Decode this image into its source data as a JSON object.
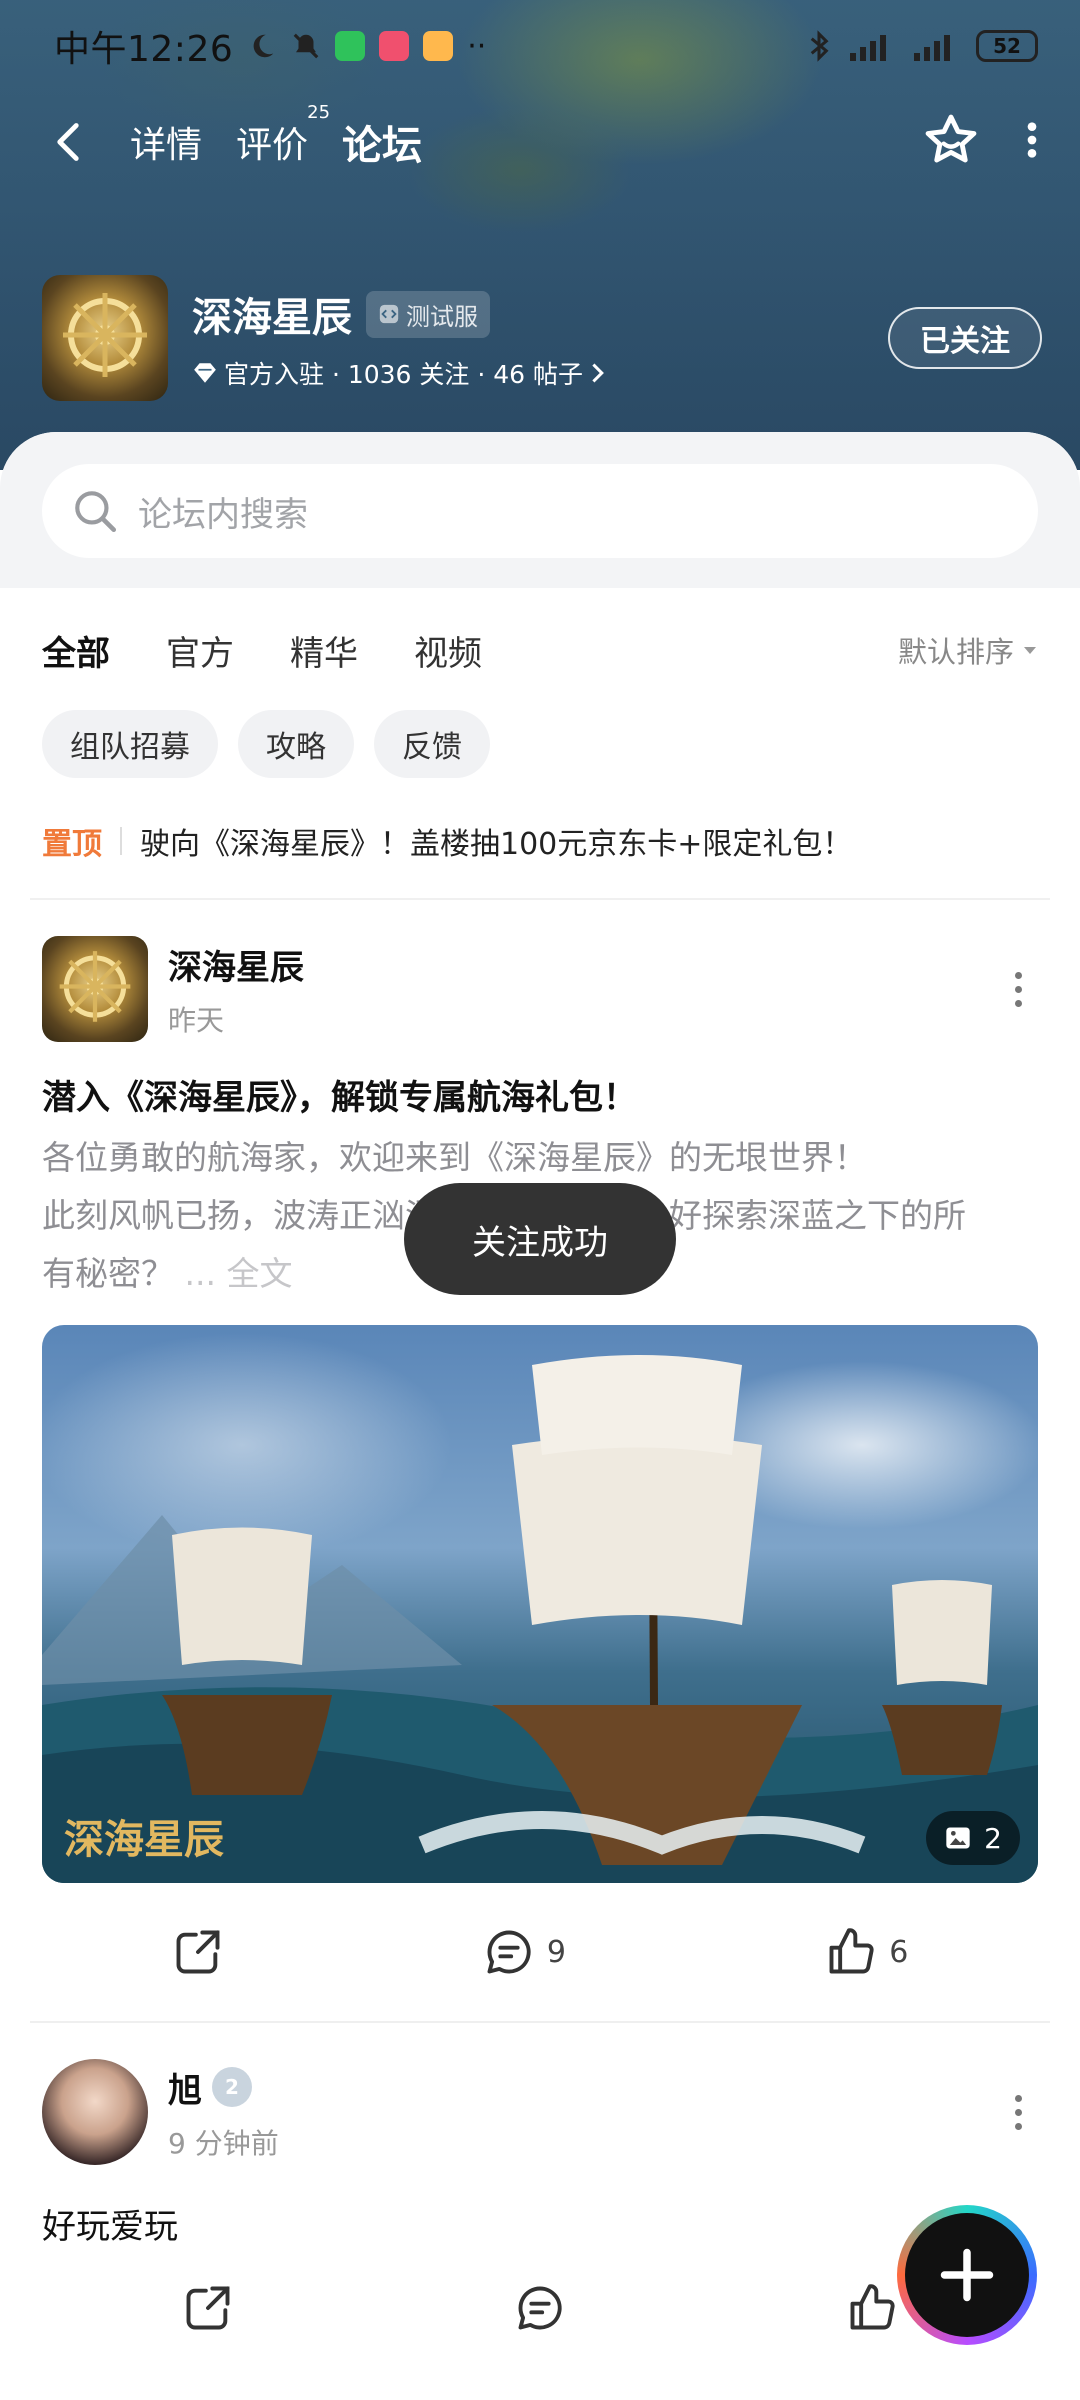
{
  "status_bar": {
    "time": "中午12:26",
    "battery": "52"
  },
  "nav": {
    "tabs": [
      {
        "label": "详情"
      },
      {
        "label": "评价",
        "badge": "25"
      },
      {
        "label": "论坛"
      }
    ],
    "active_tab": "论坛"
  },
  "game": {
    "name": "深海星辰",
    "test_badge": "测试服",
    "meta": "官方入驻 · 1036 关注 · 46 帖子",
    "follow_label": "已关注"
  },
  "search": {
    "placeholder": "论坛内搜索"
  },
  "filters": {
    "tabs": [
      "全部",
      "官方",
      "精华",
      "视频"
    ],
    "active": "全部",
    "sort_label": "默认排序"
  },
  "chips": [
    "组队招募",
    "攻略",
    "反馈"
  ],
  "pinned": {
    "tag": "置顶",
    "text": "驶向《深海星辰》！盖楼抽100元京东卡+限定礼包！"
  },
  "posts": [
    {
      "author": "深海星辰",
      "time": "昨天",
      "title": "潜入《深海星辰》，解锁专属航海礼包！",
      "body_line1": "各位勇敢的航海家，欢迎来到《深海星辰》的无垠世界！",
      "body_line2": "此刻风帆已扬，波涛正汹涌，你是否已准备好探索深蓝之下的所",
      "body_line3": "有秘密？",
      "read_more": "... 全文",
      "image_logo": "深海星辰",
      "image_count": "2",
      "comments": "9",
      "likes": "6"
    },
    {
      "author": "旭",
      "time": "9 分钟前",
      "text": "好玩爱玩",
      "level": "2"
    }
  ],
  "toast": "关注成功",
  "colors": {
    "accent": "#2fd6c5",
    "pinned": "#f07a3a",
    "toast_bg": "#333333"
  },
  "icons": [
    "back-icon",
    "star-icon",
    "more-icon",
    "search-icon",
    "share-icon",
    "comment-icon",
    "like-icon",
    "image-icon",
    "plus-icon"
  ]
}
